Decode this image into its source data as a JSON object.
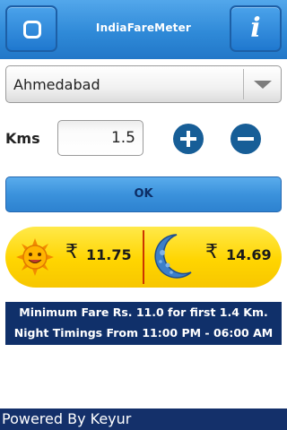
{
  "header": {
    "title": "IndiaFareMeter",
    "left_icon": "ring-icon",
    "right_icon": "info-icon",
    "info_glyph": "i"
  },
  "city": {
    "selected": "Ahmedabad"
  },
  "distance": {
    "label": "Kms",
    "value": "1.5"
  },
  "ok_label": "OK",
  "fares": {
    "currency": "₹",
    "day_value": "11.75",
    "night_value": "14.69"
  },
  "info": {
    "line1": "Minimum Fare Rs. 11.0 for first 1.4 Km.",
    "line2": "Night Timings From 11:00 PM - 06:00 AM"
  },
  "footer": {
    "text": "Powered By Keyur"
  },
  "colors": {
    "header_blue": "#2f8ad8",
    "button_blue": "#3b92dc",
    "round_button": "#175e97",
    "fare_yellow": "#ffd500",
    "divider_red": "#cc3300",
    "info_navy": "#10306a"
  }
}
